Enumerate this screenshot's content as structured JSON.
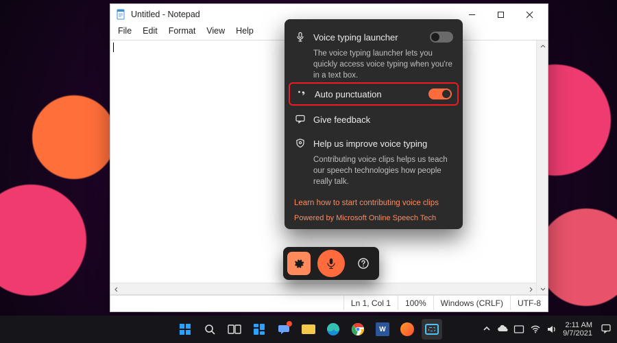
{
  "notepad": {
    "title": "Untitled - Notepad",
    "menu": {
      "file": "File",
      "edit": "Edit",
      "format": "Format",
      "view": "View",
      "help": "Help"
    },
    "status": {
      "lncol": "Ln 1, Col 1",
      "zoom": "100%",
      "eol": "Windows (CRLF)",
      "encoding": "UTF-8"
    }
  },
  "voice": {
    "launcher": {
      "label": "Voice typing launcher",
      "desc": "The voice typing launcher lets you quickly access voice typing when you're in a text box.",
      "on": false
    },
    "auto_punctuation": {
      "label": "Auto punctuation",
      "on": true
    },
    "feedback": {
      "label": "Give feedback"
    },
    "improve": {
      "label": "Help us improve voice typing",
      "desc": "Contributing voice clips helps us teach our speech technologies how people really talk."
    },
    "learn_link": "Learn how to start contributing voice clips",
    "powered": "Powered by Microsoft Online Speech Tech",
    "accent": "#ff6b3d"
  },
  "taskbar": {
    "clock": {
      "time": "2:11 AM",
      "date": "9/7/2021"
    }
  }
}
